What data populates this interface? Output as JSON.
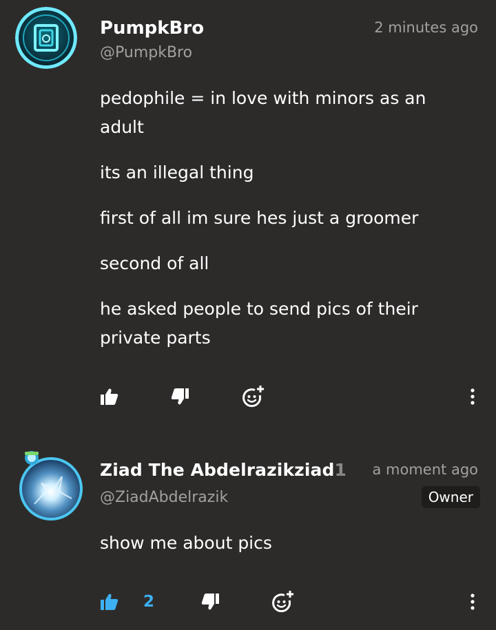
{
  "colors": {
    "background": "#2d2b2a",
    "text": "#ffffff",
    "muted": "#a3a09d",
    "accent_blue": "#3db0f2",
    "badge_bg": "#1e1d1c"
  },
  "comments": [
    {
      "display_name": "PumpkBro",
      "handle": "@PumpkBro",
      "time": "2 minutes ago",
      "paragraphs": [
        "pedophile = in love with minors as an adult",
        "its an illegal thing",
        "first of all im sure hes just a groomer",
        "second of all",
        "he asked people to send pics of their private parts"
      ],
      "liked": false,
      "like_count": "",
      "icons": [
        "thumbs-up-icon",
        "thumbs-down-icon",
        "add-reaction-icon",
        "more-vertical-icon"
      ]
    },
    {
      "display_name": "Ziad The Abdelrazikziad",
      "display_name_suffix": "1",
      "handle": "@ZiadAbdelrazik",
      "time": "a moment ago",
      "badge": "Owner",
      "paragraphs": [
        "show me about pics"
      ],
      "liked": true,
      "like_count": "2",
      "icons": [
        "thumbs-up-icon",
        "thumbs-down-icon",
        "add-reaction-icon",
        "more-vertical-icon"
      ]
    }
  ]
}
